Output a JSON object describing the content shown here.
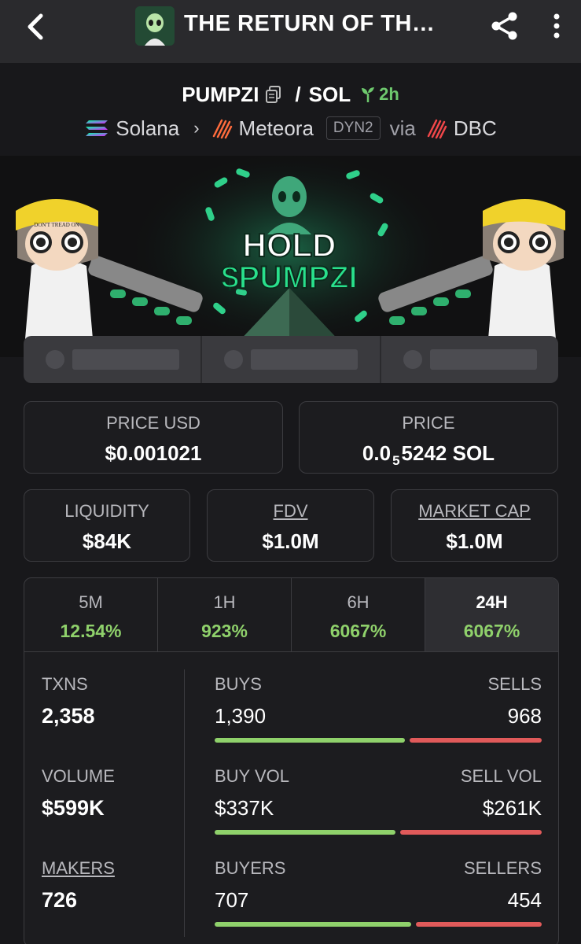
{
  "appbar": {
    "title": "THE RETURN OF TH…"
  },
  "pair": {
    "base": "PUMPZI",
    "separator": "/",
    "quote": "SOL",
    "age": "2h"
  },
  "chain": {
    "network": "Solana",
    "dex": "Meteora",
    "badge": "DYN2",
    "via": "via",
    "launchpad": "DBC"
  },
  "banner": {
    "line1": "HOLD",
    "line2": "$PUMPZI",
    "hat_text": "DON'T TREAD ON"
  },
  "prices": {
    "price_usd_label": "PRICE USD",
    "price_usd": "$0.001021",
    "price_label": "PRICE",
    "price_sol_prefix": "0.0",
    "price_sol_sub": "5",
    "price_sol_rest": "5242 SOL"
  },
  "metrics": {
    "liquidity_label": "LIQUIDITY",
    "liquidity": "$84K",
    "fdv_label": "FDV",
    "fdv": "$1.0M",
    "mcap_label": "MARKET CAP",
    "mcap": "$1.0M"
  },
  "timeframes": [
    {
      "label": "5M",
      "value": "12.54%"
    },
    {
      "label": "1H",
      "value": "923%"
    },
    {
      "label": "6H",
      "value": "6067%"
    },
    {
      "label": "24H",
      "value": "6067%"
    }
  ],
  "stats": {
    "txns_label": "TXNS",
    "txns": "2,358",
    "volume_label": "VOLUME",
    "volume": "$599K",
    "makers_label": "MAKERS",
    "makers": "726",
    "buys_label": "BUYS",
    "buys": "1,390",
    "sells_label": "SELLS",
    "sells": "968",
    "buy_vol_label": "BUY VOL",
    "buy_vol": "$337K",
    "sell_vol_label": "SELL VOL",
    "sell_vol": "$261K",
    "buyers_label": "BUYERS",
    "buyers": "707",
    "sellers_label": "SELLERS",
    "sellers": "454",
    "buys_share": 0.59,
    "buy_vol_share": 0.56,
    "buyers_share": 0.61
  },
  "colors": {
    "positive": "#8fd16b",
    "negative": "#e05a5a",
    "age": "#6ec96e",
    "banner_accent": "#19d37a"
  }
}
